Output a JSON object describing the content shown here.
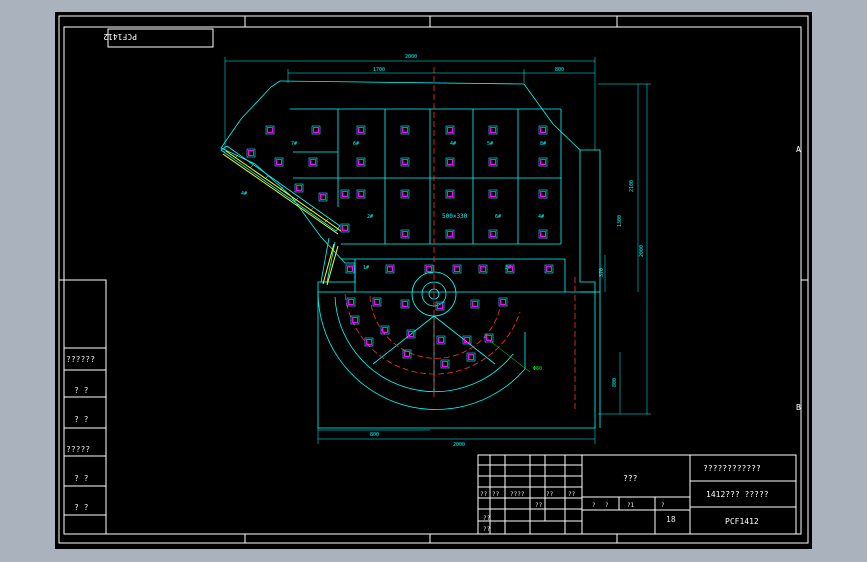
{
  "drawing": {
    "stamp": "PCF1412",
    "dims_top": [
      "2000",
      "1700",
      "800"
    ],
    "dims_right": [
      "2000",
      "2100",
      "1300",
      "370",
      "800"
    ],
    "dims_bottom": [
      "800",
      "2000"
    ],
    "panel_labels": [
      "7#",
      "6#",
      "4#",
      "5#",
      "8#",
      "6#",
      "4#",
      "3#",
      "1#",
      "2#"
    ],
    "centre_label": "500×330",
    "side_text": "4#",
    "leader_label": "Φ60",
    "zone_marks": [
      "A",
      "B"
    ]
  },
  "left_table": {
    "rows": [
      "??????",
      "? ?",
      "? ?",
      "?????",
      "? ?",
      "? ?"
    ]
  },
  "title_block": {
    "center_title": "???",
    "drawing_title": "????????????",
    "subtitle": "1412??? ?????",
    "code": "PCF1412",
    "sheet": "18",
    "small_row1": [
      "??",
      "??",
      "????",
      "??",
      "??"
    ],
    "small_row2": [
      "?",
      "?",
      "?1",
      "?"
    ],
    "bottom_left": [
      "??",
      "??",
      "??"
    ]
  },
  "colors": {
    "frame": "#00ffff",
    "table_lines": "#ffffff",
    "centerline": "#ff0000",
    "hatch": "#ffff00",
    "bolt": "#ff00ff"
  }
}
